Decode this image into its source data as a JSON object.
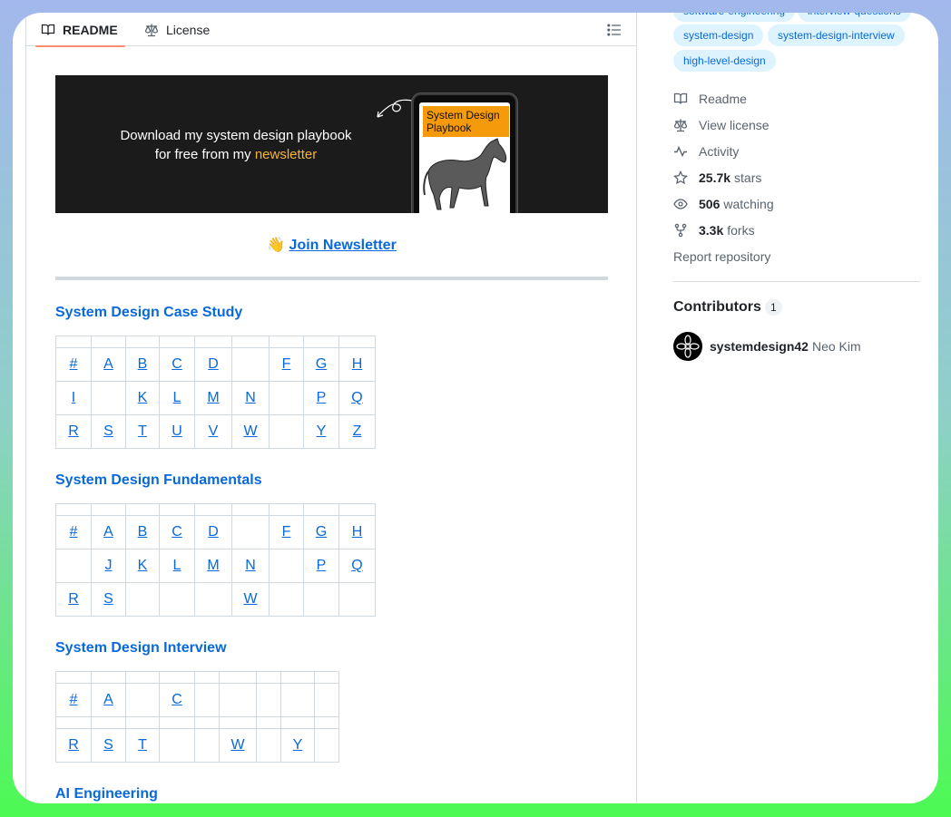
{
  "tabs": {
    "readme": "README",
    "license": "License"
  },
  "banner": {
    "line1": "Download my system design playbook",
    "line2_prefix": "for free from my ",
    "line2_highlight": "newsletter",
    "book_title": "System Design Playbook"
  },
  "newsletter": {
    "emoji": "👋",
    "link": "Join Newsletter"
  },
  "sections": [
    {
      "title": "System Design Case Study",
      "columns": 9,
      "rows": [
        [
          "#",
          "A",
          "B",
          "C",
          "D",
          "",
          "F",
          "G",
          "H"
        ],
        [
          "I",
          "",
          "K",
          "L",
          "M",
          "N",
          "",
          "P",
          "Q"
        ],
        [
          "R",
          "S",
          "T",
          "U",
          "V",
          "W",
          "",
          "Y",
          "Z"
        ]
      ]
    },
    {
      "title": "System Design Fundamentals",
      "columns": 9,
      "rows": [
        [
          "#",
          "A",
          "B",
          "C",
          "D",
          "",
          "F",
          "G",
          "H"
        ],
        [
          "",
          "J",
          "K",
          "L",
          "M",
          "N",
          "",
          "P",
          "Q"
        ],
        [
          "R",
          "S",
          "",
          "",
          "",
          "W",
          "",
          "",
          ""
        ]
      ]
    },
    {
      "title": "System Design Interview",
      "columns": 9,
      "rows": [
        [
          "#",
          "A",
          "",
          "C",
          "",
          "",
          "",
          "",
          ""
        ],
        null,
        [
          "R",
          "S",
          "T",
          "",
          "",
          "W",
          "",
          "Y",
          ""
        ]
      ]
    },
    {
      "title": "AI Engineering"
    }
  ],
  "sidebar": {
    "topics": [
      "software-engineering",
      "interview-questions",
      "system-design",
      "system-design-interview",
      "high-level-design"
    ],
    "readme": "Readme",
    "license": "View license",
    "activity": "Activity",
    "stars_count": "25.7k",
    "stars_label": "stars",
    "watching_count": "506",
    "watching_label": "watching",
    "forks_count": "3.3k",
    "forks_label": "forks",
    "report": "Report repository",
    "contributors_title": "Contributors",
    "contributors_count": "1",
    "contributor_login": "systemdesign42",
    "contributor_name": "Neo Kim"
  },
  "colors": {
    "link": "#0969da",
    "tab_underline": "#fd8c73",
    "topic_bg": "#ddf4ff",
    "banner_highlight": "#f5b437"
  }
}
